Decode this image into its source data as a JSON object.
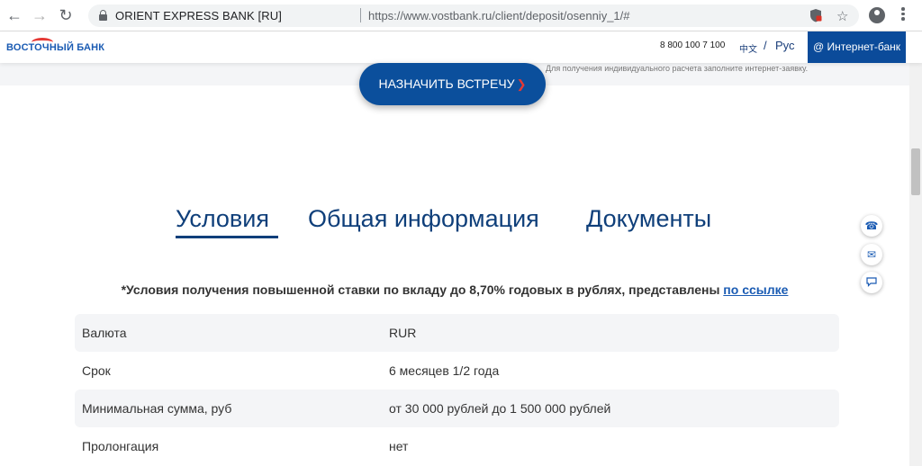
{
  "browser": {
    "site_name": "ORIENT EXPRESS BANK [RU]",
    "url": "https://www.vostbank.ru/client/deposit/osenniy_1/#",
    "icons": [
      "back-icon",
      "forward-icon",
      "reload-icon",
      "lock-icon",
      "shield-blocked-icon",
      "star-icon",
      "profile-icon",
      "menu-icon"
    ]
  },
  "header": {
    "logo": "ВОСТОЧНЫЙ БАНК",
    "phone": "8 800 100 7 100",
    "lang_zh": "中文",
    "lang_sep": "/",
    "lang_ru": "Рус",
    "internet_bank": "@ Интернет-банк"
  },
  "band": {
    "note": "Для получения индивидуального расчета заполните интернет-заявку."
  },
  "cta": {
    "label": "НАЗНАЧИТЬ ВСТРЕЧУ",
    "arrow": "❯"
  },
  "tabs": [
    {
      "label": "Условия",
      "active": true
    },
    {
      "label": "Общая информация",
      "active": false
    },
    {
      "label": "Документы",
      "active": false
    }
  ],
  "note": {
    "text": "*Условия получения повышенной ставки по вкладу до 8,70% годовых в рублях, представлены ",
    "link": "по ссылке"
  },
  "conditions": [
    {
      "label": "Валюта",
      "value": "RUR"
    },
    {
      "label": "Срок",
      "value": "6 месяцев 1/2 года"
    },
    {
      "label": "Минимальная сумма, руб",
      "value": "от 30 000 рублей до 1 500 000 рублей"
    },
    {
      "label": "Пролонгация",
      "value": "нет"
    }
  ],
  "float_icons": [
    "phone-icon",
    "mail-icon",
    "chat-icon"
  ],
  "colors": {
    "brand_blue": "#0b4b9a",
    "accent_red": "#e53935",
    "row_shade": "#f4f5f7"
  }
}
